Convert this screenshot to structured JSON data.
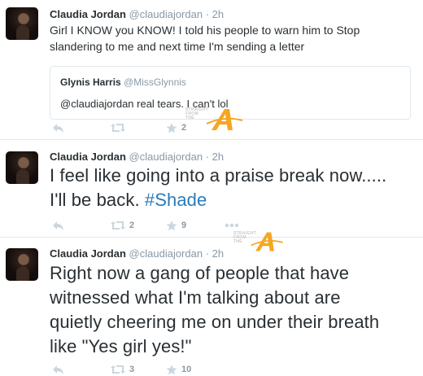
{
  "tweets": [
    {
      "name": "Claudia Jordan",
      "handle": "@claudiajordan",
      "dot": "·",
      "time": "2h",
      "text_lines": [
        "Girl I KNOW you KNOW! I told his people to warn him to Stop",
        "slandering to me and next time I'm sending a letter"
      ],
      "quote": {
        "name": "Glynis Harris",
        "handle": "@MissGlynnis",
        "text": "@claudiajordan real tears. I can't lol"
      },
      "retweets": "",
      "favorites": "2"
    },
    {
      "name": "Claudia Jordan",
      "handle": "@claudiajordan",
      "dot": "·",
      "time": "2h",
      "text_lines": [
        "I feel like going into a praise break now.....",
        "I'll be back."
      ],
      "hashtag": "#Shade",
      "retweets": "2",
      "favorites": "9"
    },
    {
      "name": "Claudia Jordan",
      "handle": "@claudiajordan",
      "dot": "·",
      "time": "2h",
      "text_lines": [
        "Right now a gang of people that have",
        "witnessed what I'm talking about are",
        "quietly cheering me on under their breath",
        "like \"Yes girl yes!\""
      ],
      "retweets": "3",
      "favorites": "10"
    }
  ],
  "watermark": {
    "small_text": "STRAIGHT FROM THE",
    "letter": "A"
  },
  "icons": {
    "reply": "reply-icon",
    "retweet": "retweet-icon",
    "favorite": "star-icon",
    "more": "more-icon"
  },
  "colors": {
    "icon_gray": "#ccd6dd",
    "text_gray": "#8899a6",
    "link_blue": "#2b7bb9",
    "divider": "#e1e8ed",
    "watermark_orange": "#f5a623"
  }
}
